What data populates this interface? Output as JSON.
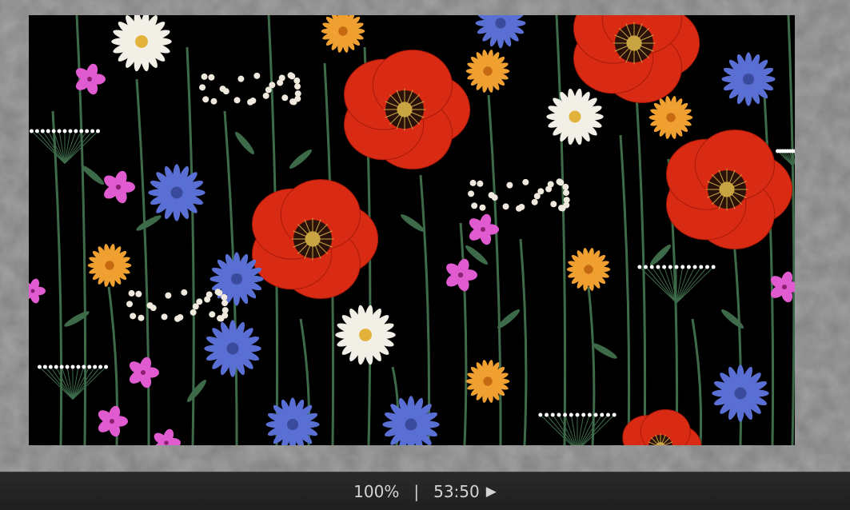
{
  "status_bar": {
    "zoom": "100%",
    "separator": "|",
    "time": "53:50",
    "play_icon": "play-icon"
  },
  "image": {
    "background_color": "#000000",
    "palette": {
      "poppy": "#d92a14",
      "poppy_center": "#c8a443",
      "cornflower": "#5a6fd4",
      "pink_flower": "#e05ad0",
      "daisy": "#f2f0e6",
      "marigold": "#f0a030",
      "stem": "#3d6b4a",
      "yarrow": "#efe8dc"
    }
  }
}
